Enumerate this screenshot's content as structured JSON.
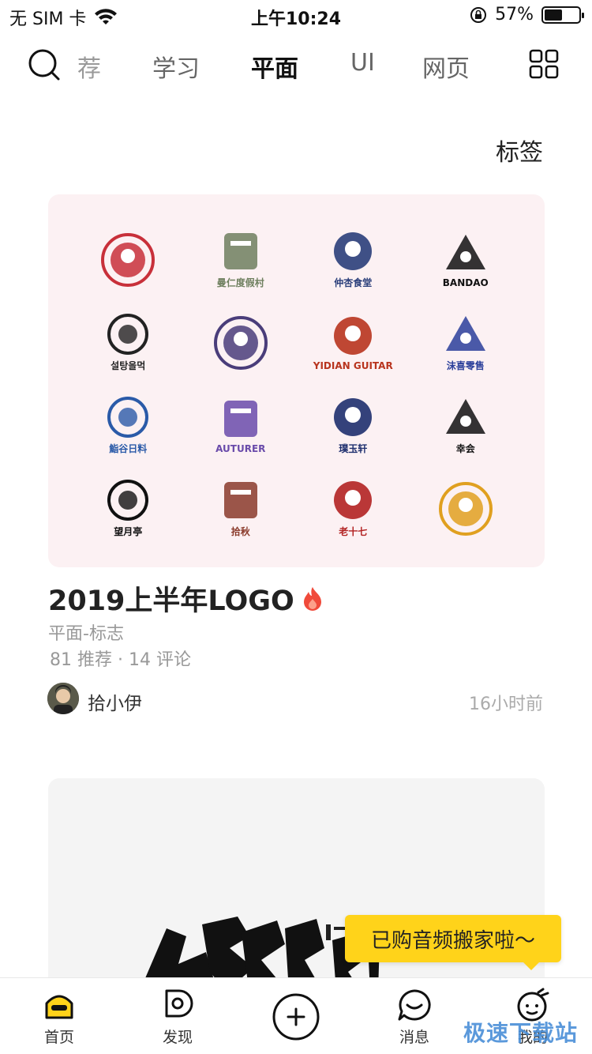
{
  "status_bar": {
    "carrier": "无 SIM 卡",
    "time": "上午10:24",
    "battery_text": "57%",
    "battery_level": 0.57
  },
  "top_nav": {
    "tabs": [
      {
        "label": "荐",
        "active": false
      },
      {
        "label": "学习",
        "active": false
      },
      {
        "label": "平面",
        "active": true
      },
      {
        "label": "UI",
        "active": false
      },
      {
        "label": "网页",
        "active": false
      }
    ],
    "search_icon": "search-icon",
    "more_icon": "grid-icon"
  },
  "tags_label": "标签",
  "card": {
    "title": "2019上半年LOGO",
    "hot_icon": "flame-icon",
    "category": "平面-标志",
    "stats": "81 推荐 · 14 评论",
    "author": "拾小伊",
    "time": "16小时前",
    "logos": [
      {
        "text": "",
        "color": "#C8303A"
      },
      {
        "text": "曼仁度假村",
        "color": "#6E7F5E"
      },
      {
        "text": "仲杏食堂",
        "color": "#2A3E7A"
      },
      {
        "text": "BANDAO",
        "color": "#111111"
      },
      {
        "text": "설탕을먹",
        "color": "#222222"
      },
      {
        "text": "",
        "color": "#4A3D7A"
      },
      {
        "text": "YIDIAN GUITAR",
        "color": "#B8341E"
      },
      {
        "text": "沫喜零售",
        "color": "#2A3E9A"
      },
      {
        "text": "鮨谷日料",
        "color": "#2A5AA8"
      },
      {
        "text": "AUTURER",
        "color": "#6A4BAA"
      },
      {
        "text": "璞玉轩",
        "color": "#1E2F6E"
      },
      {
        "text": "幸会",
        "color": "#111111"
      },
      {
        "text": "望月亭",
        "color": "#111111"
      },
      {
        "text": "拾秋",
        "color": "#8A3A2A"
      },
      {
        "text": "老十七",
        "color": "#B22222"
      },
      {
        "text": "",
        "color": "#E0A020"
      }
    ]
  },
  "toast": "已购音频搬家啦～",
  "bottom_tabs": [
    {
      "label": "首页",
      "icon": "home-icon",
      "active": true
    },
    {
      "label": "发现",
      "icon": "discover-icon",
      "active": false
    },
    {
      "label": "",
      "icon": "add-icon",
      "active": false
    },
    {
      "label": "消息",
      "icon": "message-icon",
      "active": false
    },
    {
      "label": "我的",
      "icon": "profile-icon",
      "active": false
    }
  ],
  "watermark": "极速下载站",
  "colors": {
    "accent": "#FFE100",
    "toast": "#FFD31A",
    "card_bg": "#FCF1F3"
  }
}
